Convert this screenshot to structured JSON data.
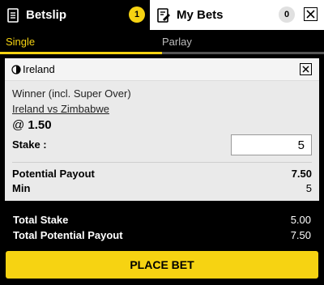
{
  "tabs": {
    "betslip": {
      "label": "Betslip",
      "count": "1"
    },
    "mybets": {
      "label": "My Bets",
      "count": "0"
    }
  },
  "subtabs": {
    "single": "Single",
    "parlay": "Parlay"
  },
  "bet": {
    "team": "Ireland",
    "market": "Winner (incl. Super Over)",
    "match": "Ireland vs Zimbabwe",
    "odds_prefix": "@",
    "odds": "1.50",
    "stake_label": "Stake :",
    "stake_value": "5",
    "potential_payout_label": "Potential Payout",
    "potential_payout": "7.50",
    "min_label": "Min",
    "min_value": "5"
  },
  "totals": {
    "stake_label": "Total Stake",
    "stake_value": "5.00",
    "payout_label": "Total Potential Payout",
    "payout_value": "7.50"
  },
  "place_bet_label": "PLACE BET",
  "colors": {
    "accent": "#f6d312",
    "background": "#000000",
    "card": "#eaeaea"
  }
}
